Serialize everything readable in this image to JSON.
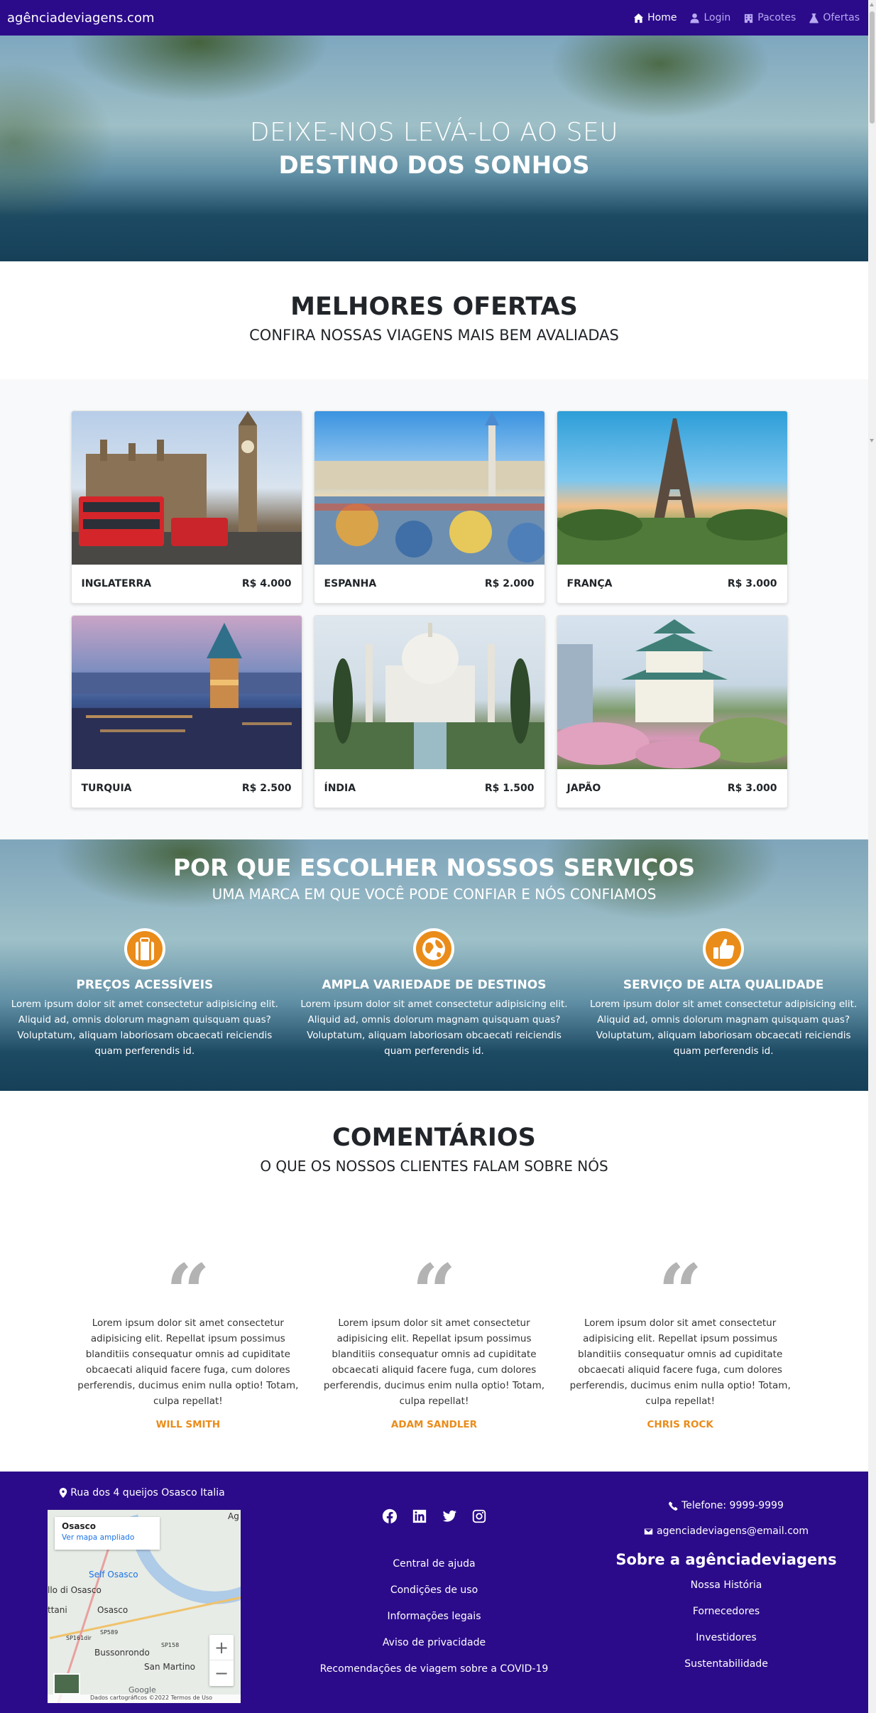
{
  "navbar": {
    "brand": "agênciadeviagens.com",
    "links": [
      {
        "label": "Home",
        "icon": "home-icon"
      },
      {
        "label": "Login",
        "icon": "user-icon"
      },
      {
        "label": "Pacotes",
        "icon": "building-icon"
      },
      {
        "label": "Ofertas",
        "icon": "flask-icon"
      }
    ]
  },
  "hero": {
    "line1": "DEIXE-NOS LEVÁ-LO AO SEU",
    "line2": "DESTINO DOS SONHOS"
  },
  "offers": {
    "title": "MELHORES OFERTAS",
    "subtitle": "CONFIRA NOSSAS VIAGENS MAIS BEM AVALIADAS",
    "items": [
      {
        "country": "INGLATERRA",
        "price": "R$ 4.000"
      },
      {
        "country": "ESPANHA",
        "price": "R$ 2.000"
      },
      {
        "country": "FRANÇA",
        "price": "R$ 3.000"
      },
      {
        "country": "TURQUIA",
        "price": "R$ 2.500"
      },
      {
        "country": "ÍNDIA",
        "price": "R$ 1.500"
      },
      {
        "country": "JAPÃO",
        "price": "R$ 3.000"
      }
    ]
  },
  "why": {
    "title": "POR QUE ESCOLHER NOSSOS SERVIÇOS",
    "subtitle": "UMA MARCA EM QUE VOCÊ PODE CONFIAR E NÓS CONFIAMOS",
    "features": [
      {
        "title": "PREÇOS ACESSÍVEIS",
        "icon": "suitcase-icon",
        "text": "Lorem ipsum dolor sit amet consectetur adipisicing elit. Aliquid ad, omnis dolorum magnam quisquam quas? Voluptatum, aliquam laboriosam obcaecati reiciendis quam perferendis id."
      },
      {
        "title": "AMPLA VARIEDADE DE DESTINOS",
        "icon": "globe-icon",
        "text": "Lorem ipsum dolor sit amet consectetur adipisicing elit. Aliquid ad, omnis dolorum magnam quisquam quas? Voluptatum, aliquam laboriosam obcaecati reiciendis quam perferendis id."
      },
      {
        "title": "SERVIÇO DE ALTA QUALIDADE",
        "icon": "thumbs-up-icon",
        "text": "Lorem ipsum dolor sit amet consectetur adipisicing elit. Aliquid ad, omnis dolorum magnam quisquam quas? Voluptatum, aliquam laboriosam obcaecati reiciendis quam perferendis id."
      }
    ],
    "accent_color": "#ea8c1a"
  },
  "comments": {
    "title": "COMENTÁRIOS",
    "subtitle": "O QUE OS NOSSOS CLIENTES FALAM SOBRE NÓS",
    "items": [
      {
        "quote": "Lorem ipsum dolor sit amet consectetur adipisicing elit. Repellat ipsum possimus blanditiis consequatur omnis ad cupiditate obcaecati aliquid facere fuga, cum dolores perferendis, ducimus enim nulla optio! Totam, culpa repellat!",
        "name": "WILL SMITH"
      },
      {
        "quote": "Lorem ipsum dolor sit amet consectetur adipisicing elit. Repellat ipsum possimus blanditiis consequatur omnis ad cupiditate obcaecati aliquid facere fuga, cum dolores perferendis, ducimus enim nulla optio! Totam, culpa repellat!",
        "name": "ADAM SANDLER"
      },
      {
        "quote": "Lorem ipsum dolor sit amet consectetur adipisicing elit. Repellat ipsum possimus blanditiis consequatur omnis ad cupiditate obcaecati aliquid facere fuga, cum dolores perferendis, ducimus enim nulla optio! Totam, culpa repellat!",
        "name": "CHRIS ROCK"
      }
    ]
  },
  "footer": {
    "address": "Rua dos 4 queijos Osasco Italia",
    "map": {
      "place": "Osasco",
      "link": "Ver mapa ampliado",
      "labels": [
        "Self Osasco",
        "llo di Osasco",
        "ttani",
        "Osasco",
        "Bussonrondo",
        "San Martino",
        "Ag",
        "SP161dir",
        "SP589",
        "SP158"
      ],
      "attribution": "Dados cartográficos ©2022   Termos de Uso",
      "google": "Google"
    },
    "socials": [
      "facebook-icon",
      "linkedin-icon",
      "twitter-icon",
      "instagram-icon"
    ],
    "links": [
      "Central de ajuda",
      "Condições de uso",
      "Informações legais",
      "Aviso de privacidade",
      "Recomendações de viagem sobre a COVID-19"
    ],
    "phone": "Telefone: 9999-9999",
    "email": "agenciadeviagens@email.com",
    "about_title": "Sobre a agênciadeviagens",
    "about_links": [
      "Nossa História",
      "Fornecedores",
      "Investidores",
      "Sustentabilidade"
    ],
    "background_color": "#2b0b8a"
  }
}
